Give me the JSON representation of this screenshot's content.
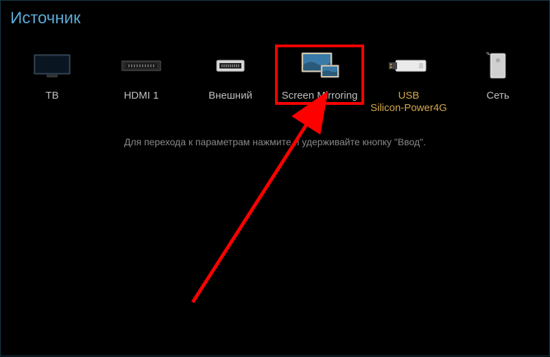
{
  "header": {
    "title": "Источник"
  },
  "sources": [
    {
      "label": "ТВ",
      "icon": "tv",
      "highlighted": false,
      "labelColor": "normal"
    },
    {
      "label": "HDMI 1",
      "icon": "hdmi",
      "highlighted": false,
      "labelColor": "normal"
    },
    {
      "label": "Внешний",
      "icon": "ext",
      "highlighted": false,
      "labelColor": "normal"
    },
    {
      "label": "Screen Mirroring",
      "icon": "screen-mirroring",
      "highlighted": true,
      "labelColor": "normal"
    },
    {
      "label": "USB\nSilicon-Power4G",
      "icon": "usb",
      "highlighted": false,
      "labelColor": "yellow"
    },
    {
      "label": "Сеть",
      "icon": "network",
      "highlighted": false,
      "labelColor": "normal"
    }
  ],
  "hint": "Для перехода к параметрам нажмите и удерживайте кнопку \"Ввод\".",
  "annotation": {
    "highlight_color": "#ff0000",
    "arrow_color": "#ff0000"
  }
}
